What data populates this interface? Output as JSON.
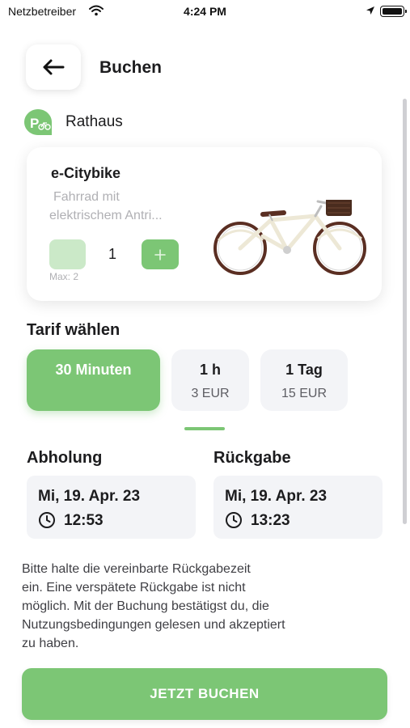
{
  "status_bar": {
    "carrier": "Netzbetreiber",
    "time": "4:24 PM"
  },
  "header": {
    "title": "Buchen",
    "back_icon": "arrow-left-icon"
  },
  "station": {
    "name": "Rathaus",
    "icon": "bike-parking-icon"
  },
  "product": {
    "name": "e-Citybike",
    "description_line1": "Fahrrad mit",
    "description_line2": "elektrischem Antri...",
    "quantity": "1",
    "max_label": "Max: 2",
    "image": "city-bike-image"
  },
  "tariff": {
    "heading": "Tarif wählen",
    "options": [
      {
        "label": "30 Minuten",
        "price": "",
        "selected": true
      },
      {
        "label": "1 h",
        "price": "3 EUR",
        "selected": false
      },
      {
        "label": "1 Tag",
        "price": "15 EUR",
        "selected": false
      }
    ]
  },
  "pickup": {
    "heading": "Abholung",
    "date": "Mi, 19. Apr. 23",
    "time": "12:53"
  },
  "return": {
    "heading": "Rückgabe",
    "date": "Mi, 19. Apr. 23",
    "time": "13:23"
  },
  "info_lines": [
    "Bitte halte die vereinbarte Rückgabezeit",
    "ein. Eine verspätete Rückgabe ist nicht",
    "möglich. Mit der Buchung bestätigst du, die",
    "Nutzungsbedingungen gelesen und akzeptiert",
    "zu haben."
  ],
  "book_button": "JETZT BUCHEN",
  "colors": {
    "accent": "#7cc675",
    "accent_light": "#cbe9c8",
    "card_bg": "#f3f4f7"
  }
}
